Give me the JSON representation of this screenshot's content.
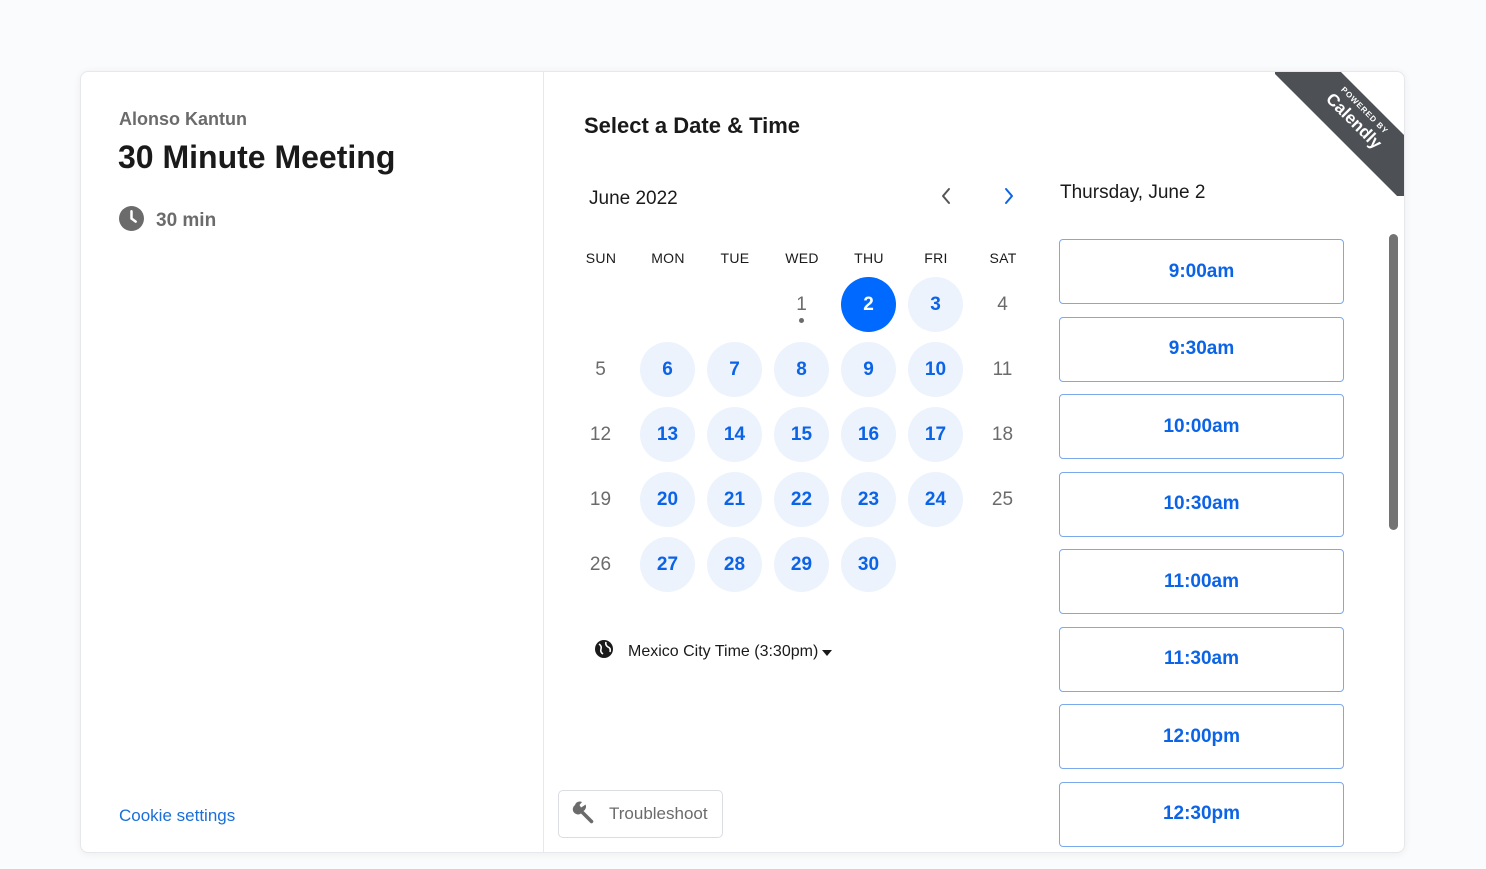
{
  "organizer": {
    "name": "Alonso Kantun"
  },
  "event": {
    "title": "30 Minute Meeting",
    "duration": "30 min"
  },
  "footer": {
    "cookie_settings": "Cookie settings",
    "troubleshoot": "Troubleshoot"
  },
  "calendar": {
    "heading": "Select a Date & Time",
    "month_label": "June 2022",
    "weekdays": [
      "SUN",
      "MON",
      "TUE",
      "WED",
      "THU",
      "FRI",
      "SAT"
    ],
    "days": [
      {
        "n": "1",
        "col": 3,
        "row": 0,
        "state": "off",
        "today": true
      },
      {
        "n": "2",
        "col": 4,
        "row": 0,
        "state": "sel"
      },
      {
        "n": "3",
        "col": 5,
        "row": 0,
        "state": "avail"
      },
      {
        "n": "4",
        "col": 6,
        "row": 0,
        "state": "off"
      },
      {
        "n": "5",
        "col": 0,
        "row": 1,
        "state": "off"
      },
      {
        "n": "6",
        "col": 1,
        "row": 1,
        "state": "avail"
      },
      {
        "n": "7",
        "col": 2,
        "row": 1,
        "state": "avail"
      },
      {
        "n": "8",
        "col": 3,
        "row": 1,
        "state": "avail"
      },
      {
        "n": "9",
        "col": 4,
        "row": 1,
        "state": "avail"
      },
      {
        "n": "10",
        "col": 5,
        "row": 1,
        "state": "avail"
      },
      {
        "n": "11",
        "col": 6,
        "row": 1,
        "state": "off"
      },
      {
        "n": "12",
        "col": 0,
        "row": 2,
        "state": "off"
      },
      {
        "n": "13",
        "col": 1,
        "row": 2,
        "state": "avail"
      },
      {
        "n": "14",
        "col": 2,
        "row": 2,
        "state": "avail"
      },
      {
        "n": "15",
        "col": 3,
        "row": 2,
        "state": "avail"
      },
      {
        "n": "16",
        "col": 4,
        "row": 2,
        "state": "avail"
      },
      {
        "n": "17",
        "col": 5,
        "row": 2,
        "state": "avail"
      },
      {
        "n": "18",
        "col": 6,
        "row": 2,
        "state": "off"
      },
      {
        "n": "19",
        "col": 0,
        "row": 3,
        "state": "off"
      },
      {
        "n": "20",
        "col": 1,
        "row": 3,
        "state": "avail"
      },
      {
        "n": "21",
        "col": 2,
        "row": 3,
        "state": "avail"
      },
      {
        "n": "22",
        "col": 3,
        "row": 3,
        "state": "avail"
      },
      {
        "n": "23",
        "col": 4,
        "row": 3,
        "state": "avail"
      },
      {
        "n": "24",
        "col": 5,
        "row": 3,
        "state": "avail"
      },
      {
        "n": "25",
        "col": 6,
        "row": 3,
        "state": "off"
      },
      {
        "n": "26",
        "col": 0,
        "row": 4,
        "state": "off"
      },
      {
        "n": "27",
        "col": 1,
        "row": 4,
        "state": "avail"
      },
      {
        "n": "28",
        "col": 2,
        "row": 4,
        "state": "avail"
      },
      {
        "n": "29",
        "col": 3,
        "row": 4,
        "state": "avail"
      },
      {
        "n": "30",
        "col": 4,
        "row": 4,
        "state": "avail"
      }
    ],
    "timezone": "Mexico City Time (3:30pm)"
  },
  "slots": {
    "date_label": "Thursday, June 2",
    "times": [
      "9:00am",
      "9:30am",
      "10:00am",
      "10:30am",
      "11:00am",
      "11:30am",
      "12:00pm",
      "12:30pm"
    ]
  },
  "badge": {
    "top": "POWERED BY",
    "brand": "Calendly"
  },
  "colors": {
    "accent": "#0069ff",
    "available_bg": "#ecf3fd",
    "link": "#1a6fd8"
  }
}
